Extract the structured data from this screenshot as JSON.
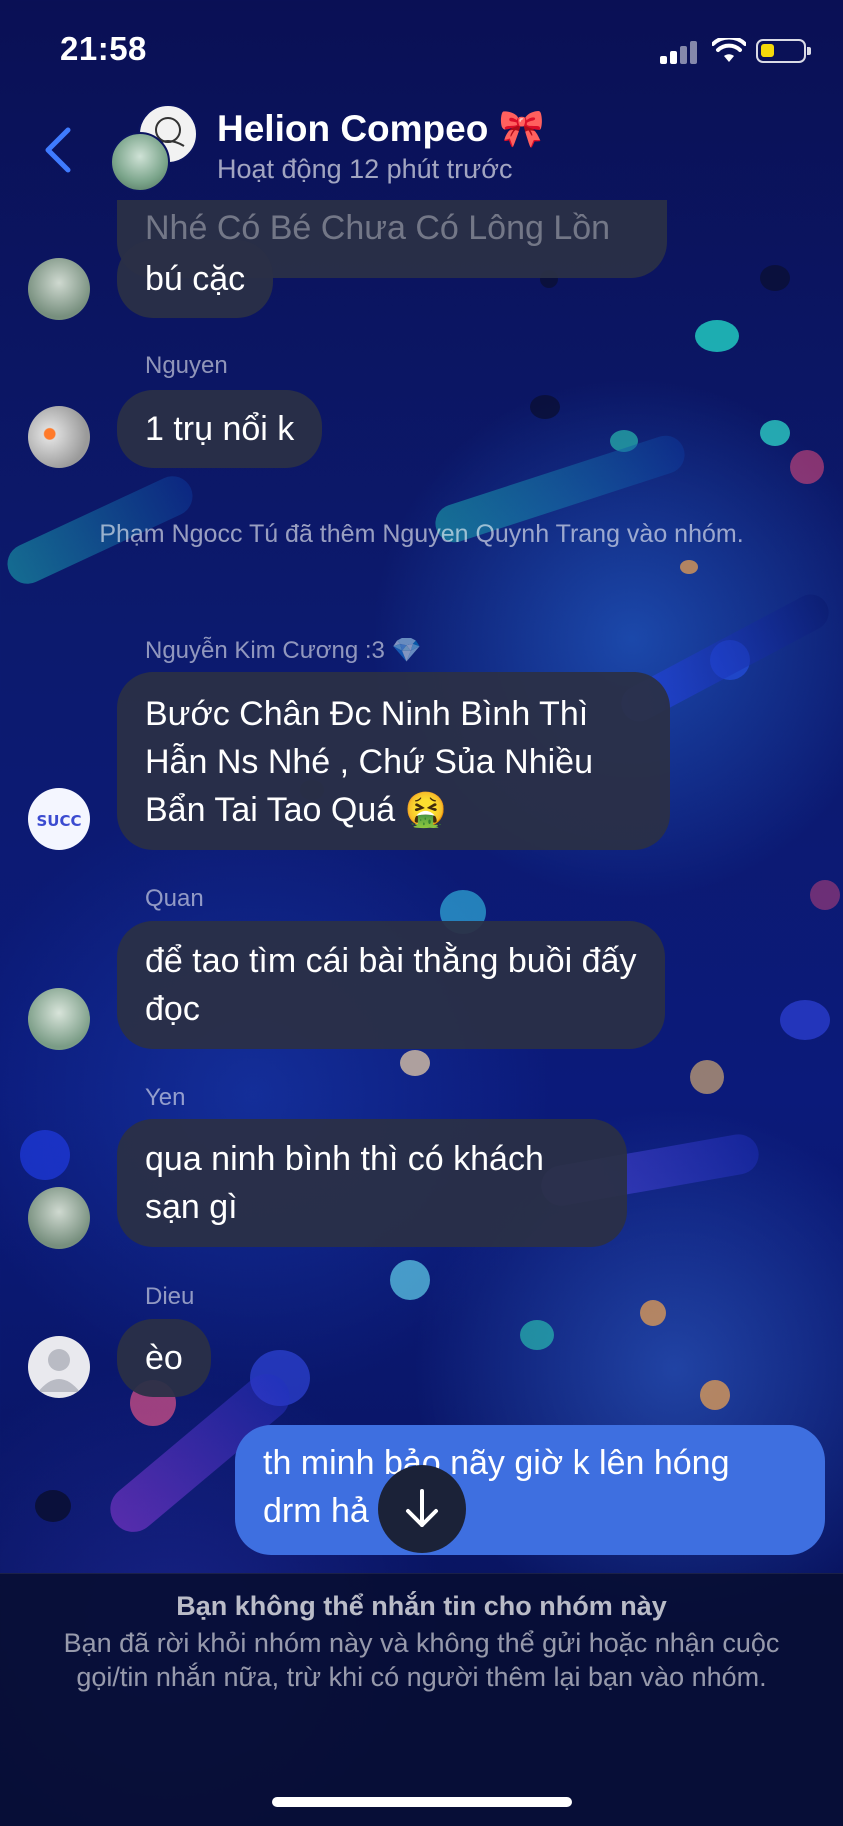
{
  "status_bar": {
    "time": "21:58",
    "battery_color": "#f5d90a"
  },
  "header": {
    "title": "Helion Compeo 🎀",
    "subtitle": "Hoạt động 12 phút trước",
    "back_icon": "chevron-left-icon"
  },
  "messages": [
    {
      "text": "Nhé Có Bé Chưa Có Lông Lồn"
    },
    {
      "text": "bú cặc"
    },
    {
      "sender": "Nguyen",
      "text": "1 trụ nổi k"
    },
    {
      "system": "Phạm Ngocc Tú đã thêm Nguyen Quynh Trang vào nhóm."
    },
    {
      "sender": "Nguyễn Kim Cương :3 💎",
      "text": "Bước Chân Đc Ninh Bình Thì Hẫn Ns Nhé , Chứ Sủa Nhiều Bẩn Tai Tao Quá 🤮"
    },
    {
      "sender": "Quan",
      "text": "để tao tìm cái bài thằng buồi đấy đọc"
    },
    {
      "sender": "Yen",
      "text": "qua ninh bình thì có khách sạn gì"
    },
    {
      "sender": "Dieu",
      "text": "èo"
    },
    {
      "text": "th minh bảo nãy giờ k lên hóng drm hả Dieu",
      "own": true
    }
  ],
  "scroll_button_icon": "arrow-down-icon",
  "footer": {
    "title": "Bạn không thể nhắn tin cho nhóm này",
    "body": "Bạn đã rời khỏi nhóm này và không thể gửi hoặc nhận cuộc gọi/tin nhắn nữa, trừ khi có người thêm lại bạn vào nhóm."
  },
  "colors": {
    "accent": "#3f7bff",
    "own_bubble": "#3e6fe0",
    "bubble": "#2a3046"
  }
}
